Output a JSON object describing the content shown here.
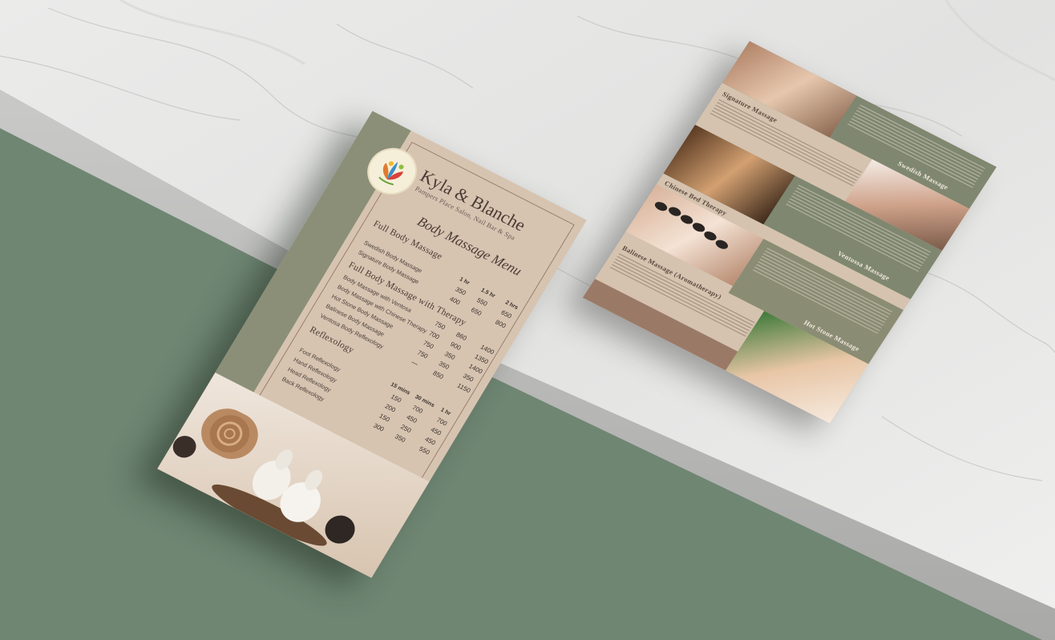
{
  "menu": {
    "brand": "Kyla & Blanche",
    "subtitle": "Pampers Place Salon, Nail Bar & Spa",
    "title": "Body Massage Menu",
    "sections": [
      {
        "name": "Full Body Massage",
        "headers": [
          "1 hr",
          "1.5 hr",
          "2 hrs"
        ],
        "items": [
          {
            "label": "Swedish Body Massage",
            "prices": [
              "350",
              "550",
              "650"
            ]
          },
          {
            "label": "Signature Body Massage",
            "prices": [
              "400",
              "650",
              "800"
            ]
          }
        ]
      },
      {
        "name": "Full Body Massage with Therapy",
        "headers": [],
        "items": [
          {
            "label": "Body Massage with Ventosa",
            "prices": [
              "750",
              "860",
              "1400"
            ]
          },
          {
            "label": "Body Massage with Chinese Therapy",
            "prices": [
              "700",
              "900",
              "1350"
            ]
          },
          {
            "label": "Hot Stone Body Massage",
            "prices": [
              "750",
              "350",
              "1400"
            ]
          },
          {
            "label": "Balinese Body Massage",
            "prices": [
              "750",
              "350",
              "350"
            ]
          },
          {
            "label": "Ventosa Body Reflexology",
            "prices": [
              "—",
              "850",
              "1150"
            ]
          }
        ]
      },
      {
        "name": "Reflexology",
        "headers": [
          "15 mins",
          "30 mins",
          "1 hr"
        ],
        "items": [
          {
            "label": "Foot Reflexology",
            "prices": [
              "150",
              "700",
              "700"
            ]
          },
          {
            "label": "Hand Reflexology",
            "prices": [
              "200",
              "450",
              "450"
            ]
          },
          {
            "label": "Head Reflexology",
            "prices": [
              "150",
              "250",
              "450"
            ]
          },
          {
            "label": "Back Reflexology",
            "prices": [
              "300",
              "350",
              "550"
            ]
          }
        ]
      }
    ]
  },
  "brochure": {
    "sections": [
      {
        "title": "Swedish Massage"
      },
      {
        "title": "Signature Massage"
      },
      {
        "title": "Chinese Bed Therapy"
      },
      {
        "title": "Ventossa Massage"
      },
      {
        "title": "Hot Stone Massage"
      },
      {
        "title": "Balinese Massage (Aromatherapy)"
      }
    ]
  },
  "colors": {
    "sage_green": "#6f8673",
    "card_beige": "#d6c4b1",
    "stripe_olive": "#8b8f78",
    "text_brown": "#4a3a33",
    "marble": "#e6e6e4"
  }
}
